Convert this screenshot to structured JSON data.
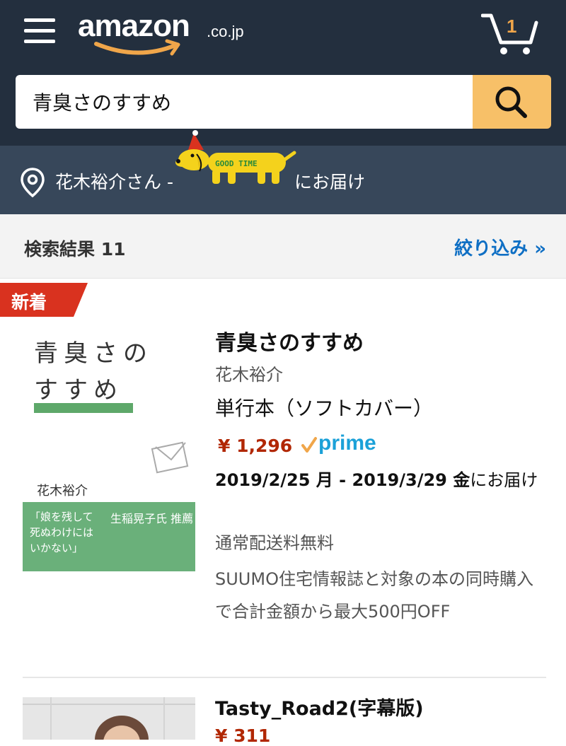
{
  "header": {
    "logo_text": "amazon",
    "logo_tld": ".co.jp",
    "cart_count": "1"
  },
  "search": {
    "value": "青臭さのすすめ"
  },
  "delivery": {
    "name_text": "花木裕介さん -",
    "suffix_text": "にお届け",
    "mascot_text": "GOOD TIME"
  },
  "results": {
    "count_text": "検索結果 11",
    "filter_label": "絞り込み »"
  },
  "products": [
    {
      "badge": "新着",
      "cover_title_line1": "青臭さの",
      "cover_title_line2": "すすめ",
      "cover_author": "花木裕介",
      "cover_quote": "「娘を残して\n死ぬわけには\nいかない」",
      "cover_endorser": "生稲晃子氏 推薦",
      "title": "青臭さのすすめ",
      "author": "花木裕介",
      "format": "単行本（ソフトカバー）",
      "price": "¥ 1,296",
      "prime_label": "prime",
      "delivery_dates": "2019/2/25 月 - 2019/3/29 金",
      "delivery_suffix": "にお届け",
      "shipping": "通常配送料無料",
      "promo": "SUUMO住宅情報誌と対象の本の同時購入で合計金額から最大500円OFF"
    },
    {
      "title": "Tasty_Road2(字幕版)",
      "price": "¥ 311"
    }
  ],
  "colors": {
    "header_bg": "#232f3e",
    "delivery_bg": "#37475a",
    "search_button": "#f7c068",
    "price": "#b12704",
    "link": "#0f6fc4",
    "badge": "#d9321f",
    "prime": "#1ba1d8"
  }
}
